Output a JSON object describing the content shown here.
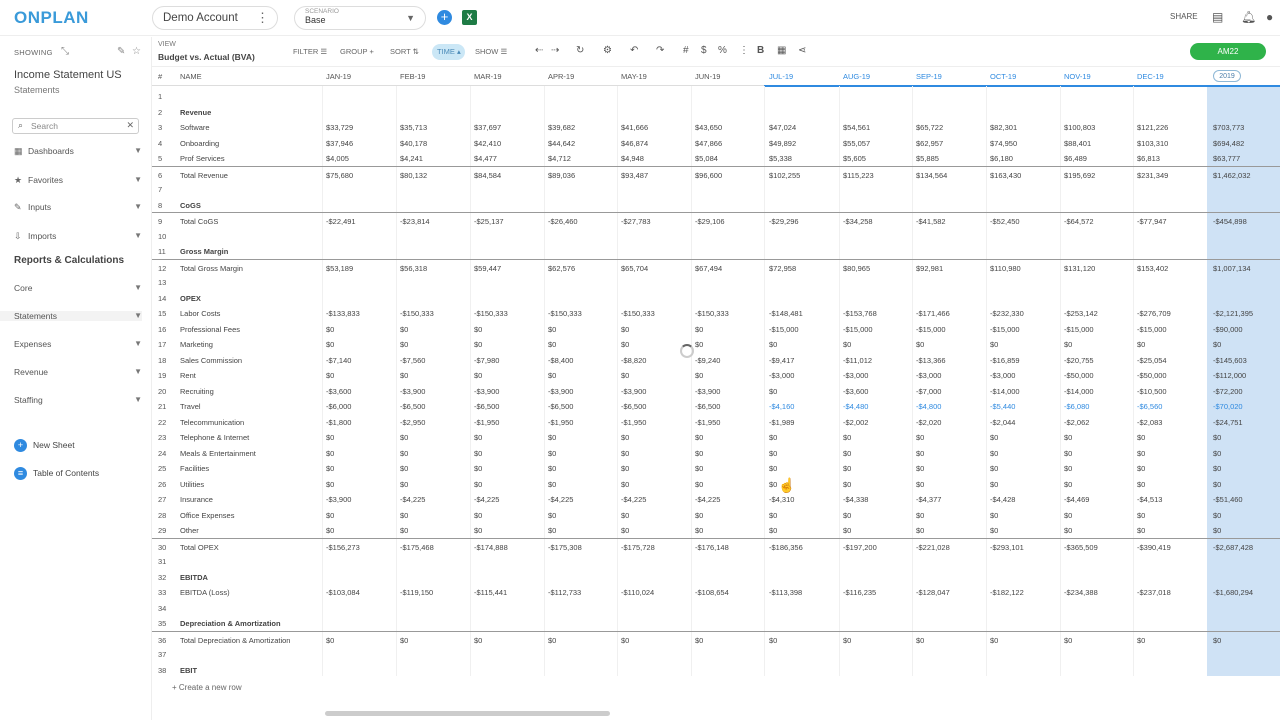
{
  "app": {
    "logo": "ONPLAN",
    "account": "Demo Account",
    "account_menu_icon": "vertical-dots-icon",
    "scenario_label": "SCENARIO",
    "scenario_value": "Base",
    "share_label": "SHARE"
  },
  "sidebar": {
    "showing_label": "SHOWING",
    "sheet_title": "Income Statement US",
    "sheet_subtitle": "Statements",
    "search_placeholder": "Search",
    "items": [
      {
        "label": "Dashboards",
        "icon": "grid-icon"
      },
      {
        "label": "Favorites",
        "icon": "star-icon"
      },
      {
        "label": "Inputs",
        "icon": "pin-icon"
      },
      {
        "label": "Imports",
        "icon": "download-icon"
      }
    ],
    "section_title": "Reports & Calculations",
    "sub_items": [
      {
        "label": "Core"
      },
      {
        "label": "Statements"
      },
      {
        "label": "Expenses"
      },
      {
        "label": "Revenue"
      },
      {
        "label": "Staffing"
      }
    ],
    "actions": [
      {
        "label": "New Sheet"
      },
      {
        "label": "Table of Contents"
      }
    ]
  },
  "toolbar": {
    "view_label": "VIEW",
    "view_value": "Budget vs. Actual (BVA)",
    "filter": "FILTER",
    "group": "GROUP",
    "sort": "SORT",
    "time": "TIME",
    "show": "SHOW",
    "undo": "UNDO",
    "redo": "REDO",
    "bold": "B",
    "am_button": "AM22"
  },
  "grid": {
    "col_hash": "#",
    "col_name": "NAME",
    "months": [
      "JAN-19",
      "FEB-19",
      "MAR-19",
      "APR-19",
      "MAY-19",
      "JUN-19",
      "JUL-19",
      "AUG-19",
      "SEP-19",
      "OCT-19",
      "NOV-19",
      "DEC-19"
    ],
    "year": "2019",
    "rows": [
      {
        "n": "1",
        "label": "",
        "bold": false,
        "values": []
      },
      {
        "n": "2",
        "label": "Revenue",
        "bold": true,
        "values": []
      },
      {
        "n": "3",
        "label": "Software",
        "values": [
          "$33,729",
          "$35,713",
          "$37,697",
          "$39,682",
          "$41,666",
          "$43,650",
          "$47,024",
          "$54,561",
          "$65,722",
          "$82,301",
          "$100,803",
          "$121,226",
          "$703,773"
        ]
      },
      {
        "n": "4",
        "label": "Onboarding",
        "values": [
          "$37,946",
          "$40,178",
          "$42,410",
          "$44,642",
          "$46,874",
          "$47,866",
          "$49,892",
          "$55,057",
          "$62,957",
          "$74,950",
          "$88,401",
          "$103,310",
          "$694,482"
        ]
      },
      {
        "n": "5",
        "label": "Prof Services",
        "values": [
          "$4,005",
          "$4,241",
          "$4,477",
          "$4,712",
          "$4,948",
          "$5,084",
          "$5,338",
          "$5,605",
          "$5,885",
          "$6,180",
          "$6,489",
          "$6,813",
          "$63,777"
        ]
      },
      {
        "n": "6",
        "label": "Total Revenue",
        "total": true,
        "values": [
          "$75,680",
          "$80,132",
          "$84,584",
          "$89,036",
          "$93,487",
          "$96,600",
          "$102,255",
          "$115,223",
          "$134,564",
          "$163,430",
          "$195,692",
          "$231,349",
          "$1,462,032"
        ]
      },
      {
        "n": "7",
        "label": "",
        "values": []
      },
      {
        "n": "8",
        "label": "CoGS",
        "bold": true,
        "values": []
      },
      {
        "n": "9",
        "label": "Total CoGS",
        "total": true,
        "values": [
          "-$22,491",
          "-$23,814",
          "-$25,137",
          "-$26,460",
          "-$27,783",
          "-$29,106",
          "-$29,296",
          "-$34,258",
          "-$41,582",
          "-$52,450",
          "-$64,572",
          "-$77,947",
          "-$454,898"
        ]
      },
      {
        "n": "10",
        "label": "",
        "values": []
      },
      {
        "n": "11",
        "label": "Gross Margin",
        "bold": true,
        "values": []
      },
      {
        "n": "12",
        "label": "Total Gross Margin",
        "total": true,
        "values": [
          "$53,189",
          "$56,318",
          "$59,447",
          "$62,576",
          "$65,704",
          "$67,494",
          "$72,958",
          "$80,965",
          "$92,981",
          "$110,980",
          "$131,120",
          "$153,402",
          "$1,007,134"
        ]
      },
      {
        "n": "13",
        "label": "",
        "values": []
      },
      {
        "n": "14",
        "label": "OPEX",
        "bold": true,
        "values": []
      },
      {
        "n": "15",
        "label": "Labor Costs",
        "values": [
          "-$133,833",
          "-$150,333",
          "-$150,333",
          "-$150,333",
          "-$150,333",
          "-$150,333",
          "-$148,481",
          "-$153,768",
          "-$171,466",
          "-$232,330",
          "-$253,142",
          "-$276,709",
          "-$2,121,395"
        ]
      },
      {
        "n": "16",
        "label": "Professional Fees",
        "values": [
          "$0",
          "$0",
          "$0",
          "$0",
          "$0",
          "$0",
          "-$15,000",
          "-$15,000",
          "-$15,000",
          "-$15,000",
          "-$15,000",
          "-$15,000",
          "-$90,000"
        ]
      },
      {
        "n": "17",
        "label": "Marketing",
        "values": [
          "$0",
          "$0",
          "$0",
          "$0",
          "$0",
          "$0",
          "$0",
          "$0",
          "$0",
          "$0",
          "$0",
          "$0",
          "$0"
        ]
      },
      {
        "n": "18",
        "label": "Sales Commission",
        "values": [
          "-$7,140",
          "-$7,560",
          "-$7,980",
          "-$8,400",
          "-$8,820",
          "-$9,240",
          "-$9,417",
          "-$11,012",
          "-$13,366",
          "-$16,859",
          "-$20,755",
          "-$25,054",
          "-$145,603"
        ]
      },
      {
        "n": "19",
        "label": "Rent",
        "values": [
          "$0",
          "$0",
          "$0",
          "$0",
          "$0",
          "$0",
          "-$3,000",
          "-$3,000",
          "-$3,000",
          "-$3,000",
          "-$50,000",
          "-$50,000",
          "-$112,000"
        ]
      },
      {
        "n": "20",
        "label": "Recruiting",
        "values": [
          "-$3,600",
          "-$3,900",
          "-$3,900",
          "-$3,900",
          "-$3,900",
          "-$3,900",
          "$0",
          "-$3,600",
          "-$7,000",
          "-$14,000",
          "-$14,000",
          "-$10,500",
          "-$72,200"
        ]
      },
      {
        "n": "21",
        "label": "Travel",
        "values": [
          "-$6,000",
          "-$6,500",
          "-$6,500",
          "-$6,500",
          "-$6,500",
          "-$6,500",
          "-$4,160",
          "-$4,480",
          "-$4,800",
          "-$5,440",
          "-$6,080",
          "-$6,560",
          "-$70,020"
        ],
        "blue_from": 6
      },
      {
        "n": "22",
        "label": "Telecommunication",
        "values": [
          "-$1,800",
          "-$2,950",
          "-$1,950",
          "-$1,950",
          "-$1,950",
          "-$1,950",
          "-$1,989",
          "-$2,002",
          "-$2,020",
          "-$2,044",
          "-$2,062",
          "-$2,083",
          "-$24,751"
        ]
      },
      {
        "n": "23",
        "label": "Telephone & Internet",
        "values": [
          "$0",
          "$0",
          "$0",
          "$0",
          "$0",
          "$0",
          "$0",
          "$0",
          "$0",
          "$0",
          "$0",
          "$0",
          "$0"
        ]
      },
      {
        "n": "24",
        "label": "Meals & Entertainment",
        "values": [
          "$0",
          "$0",
          "$0",
          "$0",
          "$0",
          "$0",
          "$0",
          "$0",
          "$0",
          "$0",
          "$0",
          "$0",
          "$0"
        ]
      },
      {
        "n": "25",
        "label": "Facilities",
        "values": [
          "$0",
          "$0",
          "$0",
          "$0",
          "$0",
          "$0",
          "$0",
          "$0",
          "$0",
          "$0",
          "$0",
          "$0",
          "$0"
        ]
      },
      {
        "n": "26",
        "label": "Utilities",
        "values": [
          "$0",
          "$0",
          "$0",
          "$0",
          "$0",
          "$0",
          "$0",
          "$0",
          "$0",
          "$0",
          "$0",
          "$0",
          "$0"
        ]
      },
      {
        "n": "27",
        "label": "Insurance",
        "values": [
          "-$3,900",
          "-$4,225",
          "-$4,225",
          "-$4,225",
          "-$4,225",
          "-$4,225",
          "-$4,310",
          "-$4,338",
          "-$4,377",
          "-$4,428",
          "-$4,469",
          "-$4,513",
          "-$51,460"
        ]
      },
      {
        "n": "28",
        "label": "Office Expenses",
        "values": [
          "$0",
          "$0",
          "$0",
          "$0",
          "$0",
          "$0",
          "$0",
          "$0",
          "$0",
          "$0",
          "$0",
          "$0",
          "$0"
        ]
      },
      {
        "n": "29",
        "label": "Other",
        "values": [
          "$0",
          "$0",
          "$0",
          "$0",
          "$0",
          "$0",
          "$0",
          "$0",
          "$0",
          "$0",
          "$0",
          "$0",
          "$0"
        ]
      },
      {
        "n": "30",
        "label": "Total OPEX",
        "total": true,
        "values": [
          "-$156,273",
          "-$175,468",
          "-$174,888",
          "-$175,308",
          "-$175,728",
          "-$176,148",
          "-$186,356",
          "-$197,200",
          "-$221,028",
          "-$293,101",
          "-$365,509",
          "-$390,419",
          "-$2,687,428"
        ]
      },
      {
        "n": "31",
        "label": "",
        "values": []
      },
      {
        "n": "32",
        "label": "EBITDA",
        "bold": true,
        "values": []
      },
      {
        "n": "33",
        "label": "EBITDA (Loss)",
        "values": [
          "-$103,084",
          "-$119,150",
          "-$115,441",
          "-$112,733",
          "-$110,024",
          "-$108,654",
          "-$113,398",
          "-$116,235",
          "-$128,047",
          "-$182,122",
          "-$234,388",
          "-$237,018",
          "-$1,680,294"
        ]
      },
      {
        "n": "34",
        "label": "",
        "values": []
      },
      {
        "n": "35",
        "label": "Depreciation & Amortization",
        "bold": true,
        "values": []
      },
      {
        "n": "36",
        "label": "Total Depreciation & Amortization",
        "total": true,
        "values": [
          "$0",
          "$0",
          "$0",
          "$0",
          "$0",
          "$0",
          "$0",
          "$0",
          "$0",
          "$0",
          "$0",
          "$0",
          "$0"
        ]
      },
      {
        "n": "37",
        "label": "",
        "values": []
      },
      {
        "n": "38",
        "label": "EBIT",
        "bold": true,
        "values": []
      }
    ],
    "new_row": "+ Create a new row"
  }
}
